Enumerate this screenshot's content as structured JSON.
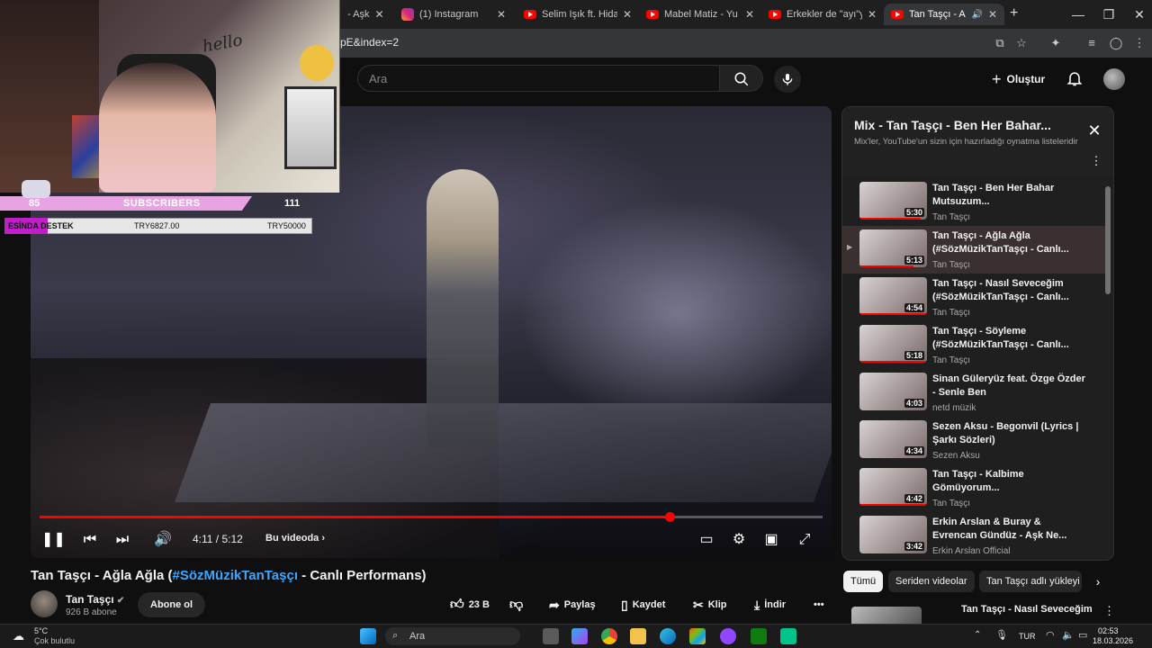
{
  "browser": {
    "tabs": [
      {
        "label": "- Aşk",
        "icon": "youtube-icon"
      },
      {
        "label": "(1) Instagram",
        "icon": "instagram-icon"
      },
      {
        "label": "Selim Işık ft. Hidayet",
        "icon": "youtube-icon"
      },
      {
        "label": "Mabel Matiz - Yusuf",
        "icon": "youtube-icon"
      },
      {
        "label": "Erkekler de \"ayı\"yı se",
        "icon": "youtube-icon"
      },
      {
        "label": "Tan Taşçı - Ağla A",
        "icon": "youtube-icon",
        "active": true
      }
    ],
    "close_glyph": "✕",
    "new_tab_glyph": "+",
    "url": "pE&index=2"
  },
  "header": {
    "search_placeholder": "Ara",
    "create_label": "Oluştur"
  },
  "video": {
    "time": "4:11 / 5:12",
    "chapter_label": "Bu videoda",
    "progress": 0.8045,
    "title_prefix": "Tan Taşçı - Ağla Ağla (",
    "title_tag": "#SözMüzikTanTaşçı",
    "title_suffix": " - Canlı Performans)"
  },
  "channel": {
    "name": "Tan Taşçı",
    "subscribers": "926 B abone",
    "subscribe_label": "Abone ol"
  },
  "actions": {
    "like_count": "23 B",
    "share": "Paylaş",
    "save": "Kaydet",
    "clip": "Klip",
    "download": "İndir"
  },
  "overlay": {
    "hello": "hello",
    "subs_left": "85",
    "subs_label": "SUBSCRIBERS",
    "subs_right": "111",
    "donate_label": "ESİNDA DESTEK",
    "donate_current": "TRY6827.00",
    "donate_goal": "TRY50000"
  },
  "playlist": {
    "title": "Mix - Tan Taşçı - Ben Her Bahar...",
    "subtitle": "Mix'ler, YouTube'un sizin için hazırladığı oynatma listeleridir",
    "items": [
      {
        "title": "Tan Taşçı - Ben Her Bahar Mutsuzum...",
        "channel": "Tan Taşçı",
        "duration": "5:30",
        "watched": 0.9
      },
      {
        "title": "Tan Taşçı - Ağla Ağla (#SözMüzikTanTaşçı - Canlı...",
        "channel": "Tan Taşçı",
        "duration": "5:13",
        "watched": 0.8,
        "active": true
      },
      {
        "title": "Tan Taşçı - Nasıl Seveceğim (#SözMüzikTanTaşçı - Canlı...",
        "channel": "Tan Taşçı",
        "duration": "4:54",
        "watched": 1.0
      },
      {
        "title": "Tan Taşçı - Söyleme (#SözMüzikTanTaşçı - Canlı...",
        "channel": "Tan Taşçı",
        "duration": "5:18",
        "watched": 1.0
      },
      {
        "title": "Sinan Güleryüz feat. Özge Özder - Senle Ben",
        "channel": "netd müzik",
        "duration": "4:03",
        "watched": 0
      },
      {
        "title": "Sezen Aksu - Begonvil (Lyrics | Şarkı Sözleri)",
        "channel": "Sezen Aksu",
        "duration": "4:34",
        "watched": 0
      },
      {
        "title": "Tan Taşçı - Kalbime Gömüyorum...",
        "channel": "Tan Taşçı",
        "duration": "4:42",
        "watched": 1.0
      },
      {
        "title": "Erkin Arslan & Buray & Evrencan Gündüz - Aşk Ne...",
        "channel": "Erkin Arslan Official",
        "duration": "3:42",
        "watched": 0
      }
    ]
  },
  "chips": [
    "Tümü",
    "Seriden videolar",
    "Tan Taşçı adlı yükleyi"
  ],
  "next_video_title": "Tan Taşçı - Nasıl Seveceğim",
  "taskbar": {
    "temperature": "5°C",
    "weather": "Çok bulutlu",
    "search": "Ara",
    "lang": "TUR",
    "time": "02:53",
    "date": "18.03.2026"
  },
  "colors": {
    "accent": "#ff0000",
    "link": "#3ea6ff",
    "bg": "#0f0f0f"
  }
}
